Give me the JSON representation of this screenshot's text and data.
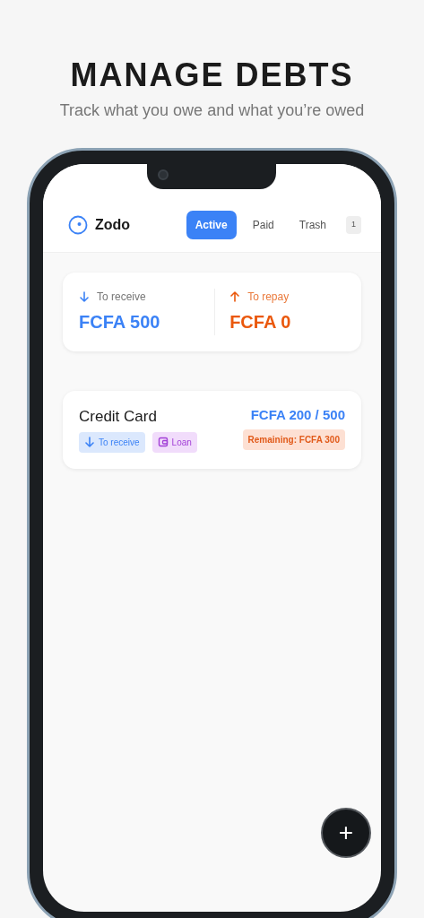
{
  "promo": {
    "title": "MANAGE DEBTS",
    "subtitle": "Track what you owe and what you’re owed"
  },
  "app": {
    "name": "Zodo"
  },
  "tabs": [
    {
      "label": "Active",
      "selected": true
    },
    {
      "label": "Paid",
      "selected": false
    },
    {
      "label": "Trash",
      "selected": false
    }
  ],
  "trash_count": "1",
  "summary": [
    {
      "kind": "receive",
      "label": "To receive",
      "amount": "FCFA 500"
    },
    {
      "kind": "repay",
      "label": "To repay",
      "amount": "FCFA 0"
    }
  ],
  "debts": [
    {
      "name": "Credit Card",
      "progress": "FCFA 200 / 500",
      "remaining": "Remaining: FCFA 300",
      "tags": [
        {
          "kind": "receive",
          "label": "To receive"
        },
        {
          "kind": "loan",
          "label": "Loan"
        }
      ]
    }
  ],
  "fab": {
    "label": "+"
  }
}
